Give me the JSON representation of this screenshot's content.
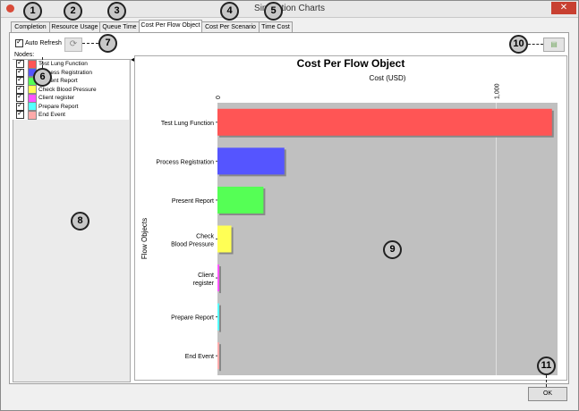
{
  "window": {
    "title": "Simulation Charts"
  },
  "tabs": [
    {
      "label": "Completion"
    },
    {
      "label": "Resource Usage"
    },
    {
      "label": "Queue Time"
    },
    {
      "label": "Cost Per Flow Object"
    },
    {
      "label": "Cost Per Scenario"
    },
    {
      "label": "Time Cost"
    }
  ],
  "controls": {
    "auto_refresh_label": "Auto Refresh",
    "nodes_label": "Nodes:",
    "ok_label": "OK"
  },
  "nodes": [
    {
      "label": "Test Lung Function",
      "color": "#ff5555"
    },
    {
      "label": "Process Registration",
      "color": "#5555ff"
    },
    {
      "label": "Present Report",
      "color": "#55ff55"
    },
    {
      "label": "Check Blood Pressure",
      "color": "#ffff55"
    },
    {
      "label": "Client register",
      "color": "#ff55ff"
    },
    {
      "label": "Prepare Report",
      "color": "#55ffff"
    },
    {
      "label": "End Event",
      "color": "#ffaaaa"
    }
  ],
  "callouts": [
    "1",
    "2",
    "3",
    "4",
    "5",
    "6",
    "7",
    "8",
    "9",
    "10",
    "11"
  ],
  "chart_data": {
    "type": "bar",
    "orientation": "horizontal",
    "title": "Cost Per Flow Object",
    "xlabel": "Cost (USD)",
    "ylabel": "Flow Objects",
    "categories": [
      "Test Lung Function",
      "Process Registration",
      "Present Report",
      "Check Blood Pressure",
      "Client register",
      "Prepare Report",
      "End Event"
    ],
    "category_lines": [
      [
        "Test Lung Function"
      ],
      [
        "Process Registration"
      ],
      [
        "Present Report"
      ],
      [
        "Check",
        "Blood Pressure"
      ],
      [
        "Client",
        "register"
      ],
      [
        "Prepare Report"
      ],
      [
        "End Event"
      ]
    ],
    "values": [
      1200,
      240,
      165,
      50,
      5,
      5,
      5
    ],
    "colors": [
      "#ff5555",
      "#5555ff",
      "#55ff55",
      "#ffff55",
      "#ff55ff",
      "#55ffff",
      "#ffaaaa"
    ],
    "xlim": [
      0,
      1220
    ],
    "xticks": [
      0,
      1000
    ],
    "xtick_labels": [
      "0",
      "1,000"
    ],
    "plot_background": "#c0c0c0",
    "grid": true
  }
}
